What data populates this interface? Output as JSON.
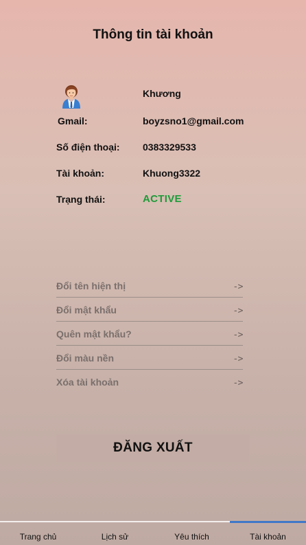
{
  "header": {
    "title": "Thông tin tài khoản"
  },
  "profile": {
    "avatar_icon": "user-avatar-icon",
    "name": "Khương",
    "rows": [
      {
        "label": "Gmail:",
        "value": "boyzsno1@gmail.com"
      },
      {
        "label": "Số điện thoại:",
        "value": "0383329533"
      },
      {
        "label": "Tài khoản:",
        "value": "Khuong3322"
      },
      {
        "label": "Trạng thái:",
        "value": "ACTIVE"
      }
    ],
    "status_color": "#1e9b3a"
  },
  "settings": {
    "items": [
      {
        "label": "Đổi tên hiện thị",
        "arrow": "->"
      },
      {
        "label": "Đổi mật khẩu",
        "arrow": "->"
      },
      {
        "label": "Quên mật khẩu?",
        "arrow": "->"
      },
      {
        "label": "Đổi màu nền",
        "arrow": "->"
      },
      {
        "label": "Xóa tài khoản",
        "arrow": "->"
      }
    ]
  },
  "logout": {
    "label": "ĐĂNG XUẤT"
  },
  "nav": {
    "tabs": [
      {
        "label": "Trang chủ"
      },
      {
        "label": "Lịch sử"
      },
      {
        "label": "Yêu thích"
      },
      {
        "label": "Tài khoản"
      }
    ],
    "active_index": 3,
    "accent_color": "#3f78c8"
  }
}
